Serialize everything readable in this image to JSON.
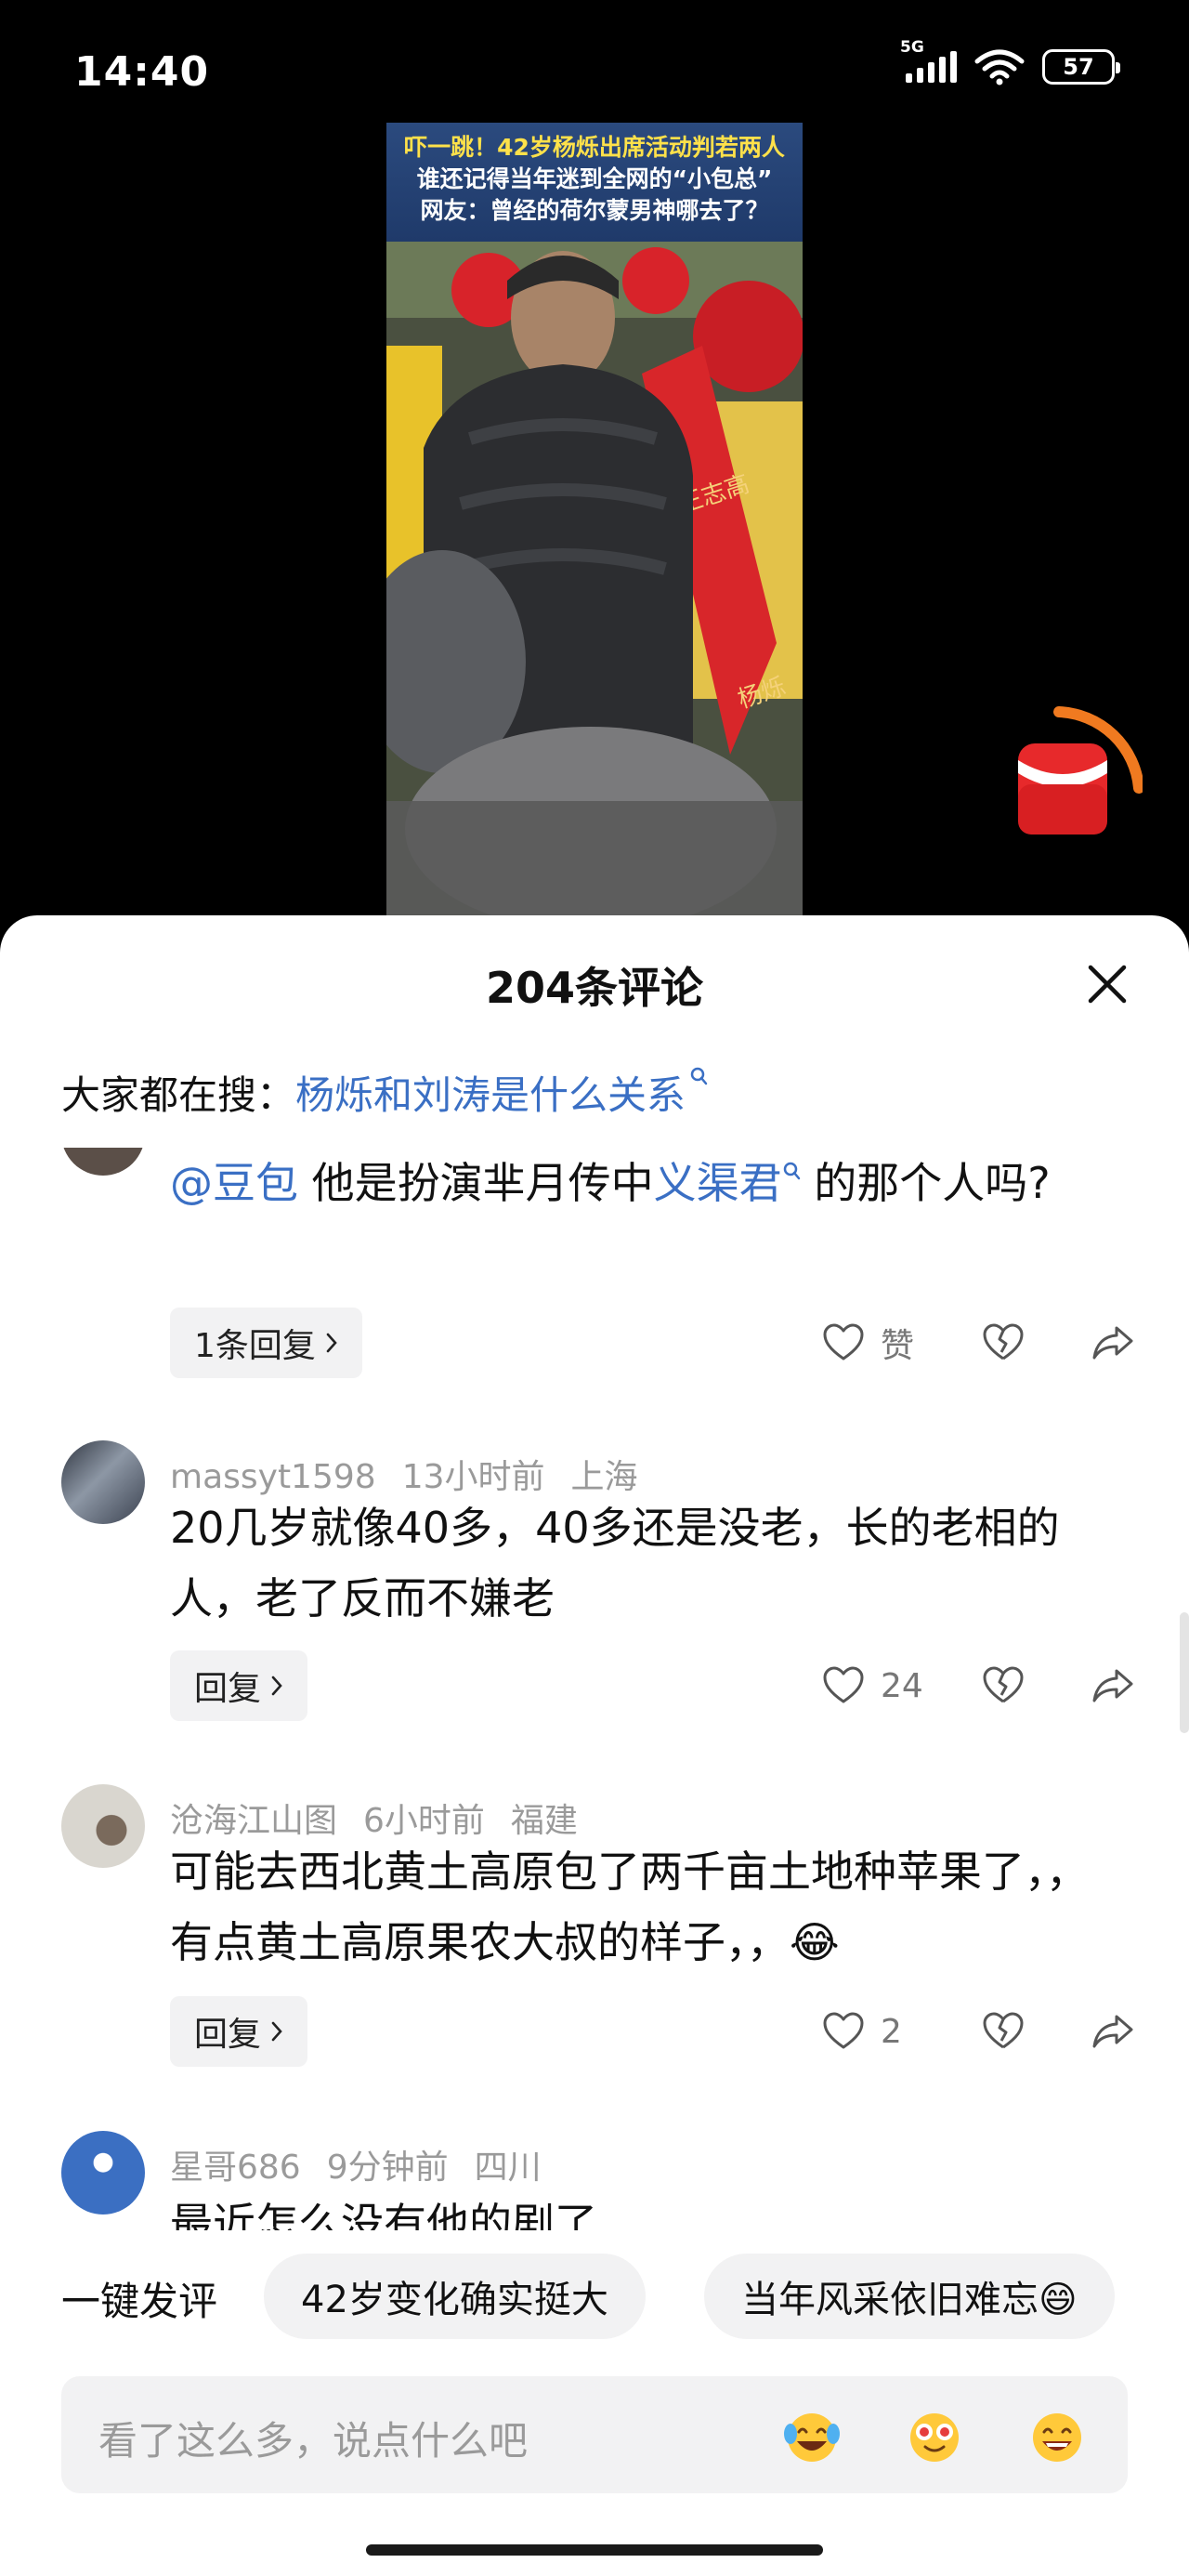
{
  "status_bar": {
    "time": "14:40",
    "network": "5G",
    "battery": "57"
  },
  "video": {
    "caption_lines": [
      "吓一跳！42岁杨烁出席活动判若两人",
      "谁还记得当年迷到全网的“小包总”",
      "网友：曾经的荷尔蒙男神哪去了？"
    ],
    "banner_text_1": "王志高",
    "banner_text_2": "杨烁"
  },
  "sheet": {
    "title": "204条评论",
    "search_prefix": "大家都在搜：",
    "search_link": "杨烁和刘涛是什么关系"
  },
  "comments": [
    {
      "mention": "@豆包",
      "text_before": " 他是扮演芈月传中",
      "link": "义渠君",
      "text_after": " 的那个人吗?",
      "reply_label": "1条回复",
      "like_label": "赞"
    },
    {
      "user": "massyt1598",
      "time": "13小时前",
      "location": "上海",
      "text": "20几岁就像40多，40多还是没老，长的老相的人，老了反而不嫌老",
      "reply_label": "回复",
      "like_count": "24"
    },
    {
      "user": "沧海江山图",
      "time": "6小时前",
      "location": "福建",
      "text": "可能去西北黄土高原包了两千亩土地种苹果了，，  有点黄土高原果农大叔的样子，，😂",
      "reply_label": "回复",
      "like_count": "2"
    },
    {
      "user": "星哥686",
      "time": "9分钟前",
      "location": "四川",
      "text": "最近怎么没有他的剧了"
    }
  ],
  "quick_comment": {
    "label": "一键发评",
    "chips": [
      "42岁变化确实挺大",
      "当年风采依旧难忘😄"
    ]
  },
  "input": {
    "placeholder": "看了这么多，说点什么吧",
    "emojis": [
      "laugh-cry-emoji",
      "star-eyes-emoji",
      "grin-emoji"
    ]
  },
  "colors": {
    "link": "#3a6fc4",
    "chip_bg": "#f2f2f3",
    "meta": "#9a9a9a"
  }
}
